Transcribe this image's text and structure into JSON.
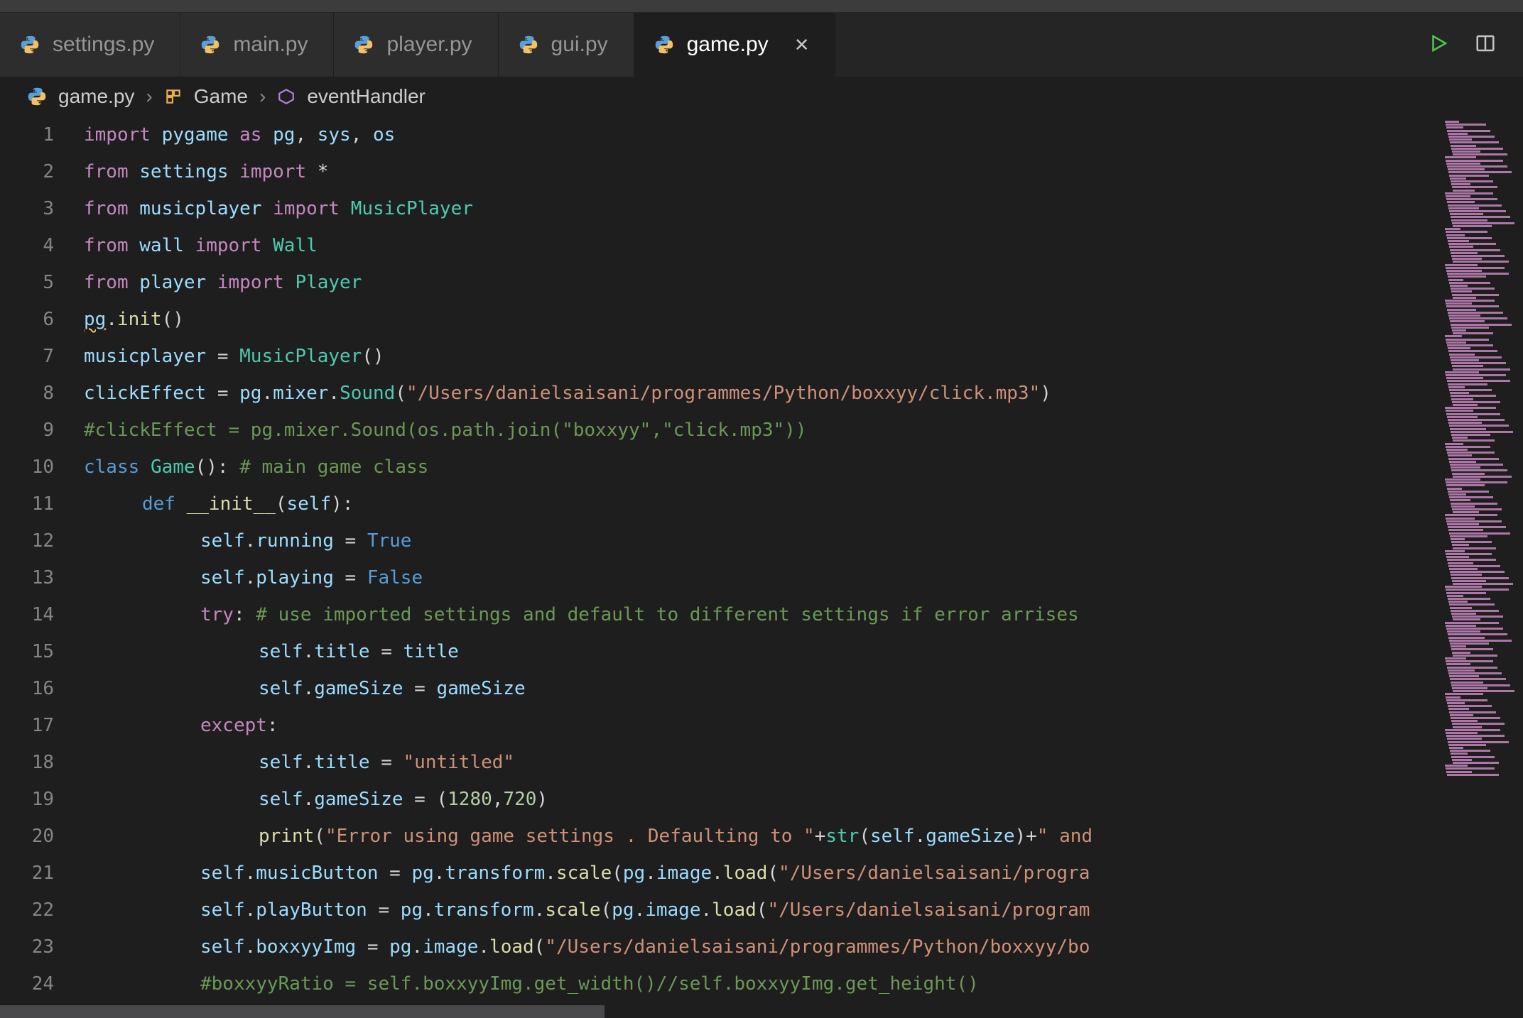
{
  "tabs": [
    {
      "label": "settings.py",
      "active": false
    },
    {
      "label": "main.py",
      "active": false
    },
    {
      "label": "player.py",
      "active": false
    },
    {
      "label": "gui.py",
      "active": false
    },
    {
      "label": "game.py",
      "active": true
    }
  ],
  "breadcrumb": {
    "file": "game.py",
    "class": "Game",
    "method": "eventHandler"
  },
  "icons": {
    "python": "python-icon",
    "close": "✕",
    "run": "▷",
    "chevron": "›",
    "class": "class-icon",
    "method": "method-icon",
    "split": "split-icon"
  },
  "code": [
    {
      "n": 1,
      "ind": 0,
      "spans": [
        [
          "kw",
          "import"
        ],
        [
          "op",
          " "
        ],
        [
          "var",
          "pygame"
        ],
        [
          "op",
          " "
        ],
        [
          "kw",
          "as"
        ],
        [
          "op",
          " "
        ],
        [
          "var",
          "pg"
        ],
        [
          "op",
          ", "
        ],
        [
          "var",
          "sys"
        ],
        [
          "op",
          ", "
        ],
        [
          "var",
          "os"
        ]
      ]
    },
    {
      "n": 2,
      "ind": 0,
      "spans": [
        [
          "kw",
          "from"
        ],
        [
          "op",
          " "
        ],
        [
          "var",
          "settings"
        ],
        [
          "op",
          " "
        ],
        [
          "kw",
          "import"
        ],
        [
          "op",
          " *"
        ]
      ]
    },
    {
      "n": 3,
      "ind": 0,
      "spans": [
        [
          "kw",
          "from"
        ],
        [
          "op",
          " "
        ],
        [
          "var",
          "musicplayer"
        ],
        [
          "op",
          " "
        ],
        [
          "kw",
          "import"
        ],
        [
          "op",
          " "
        ],
        [
          "cls",
          "MusicPlayer"
        ]
      ]
    },
    {
      "n": 4,
      "ind": 0,
      "spans": [
        [
          "kw",
          "from"
        ],
        [
          "op",
          " "
        ],
        [
          "var",
          "wall"
        ],
        [
          "op",
          " "
        ],
        [
          "kw",
          "import"
        ],
        [
          "op",
          " "
        ],
        [
          "cls",
          "Wall"
        ]
      ]
    },
    {
      "n": 5,
      "ind": 0,
      "spans": [
        [
          "kw",
          "from"
        ],
        [
          "op",
          " "
        ],
        [
          "var",
          "player"
        ],
        [
          "op",
          " "
        ],
        [
          "kw",
          "import"
        ],
        [
          "op",
          " "
        ],
        [
          "cls",
          "Player"
        ]
      ]
    },
    {
      "n": 6,
      "ind": 0,
      "spans": [
        [
          "var err",
          "pg"
        ],
        [
          "op",
          "."
        ],
        [
          "fn",
          "init"
        ],
        [
          "op",
          "()"
        ]
      ]
    },
    {
      "n": 7,
      "ind": 0,
      "spans": [
        [
          "var",
          "musicplayer"
        ],
        [
          "op",
          " = "
        ],
        [
          "cls",
          "MusicPlayer"
        ],
        [
          "op",
          "()"
        ]
      ]
    },
    {
      "n": 8,
      "ind": 0,
      "spans": [
        [
          "var",
          "clickEffect"
        ],
        [
          "op",
          " = "
        ],
        [
          "var",
          "pg"
        ],
        [
          "op",
          "."
        ],
        [
          "var",
          "mixer"
        ],
        [
          "op",
          "."
        ],
        [
          "cls",
          "Sound"
        ],
        [
          "op",
          "("
        ],
        [
          "str",
          "\"/Users/danielsaisani/programmes/Python/boxxyy/click.mp3\""
        ],
        [
          "op",
          ")"
        ]
      ]
    },
    {
      "n": 9,
      "ind": 0,
      "spans": [
        [
          "cmt",
          "#clickEffect = pg.mixer.Sound(os.path.join(\"boxxyy\",\"click.mp3\"))"
        ]
      ]
    },
    {
      "n": 10,
      "ind": 0,
      "spans": [
        [
          "kw2",
          "class"
        ],
        [
          "op",
          " "
        ],
        [
          "cls",
          "Game"
        ],
        [
          "op",
          "(): "
        ],
        [
          "cmt",
          "# main game class"
        ]
      ]
    },
    {
      "n": 11,
      "ind": 1,
      "spans": [
        [
          "kw2",
          "def"
        ],
        [
          "op",
          " "
        ],
        [
          "fn",
          "__init__"
        ],
        [
          "op",
          "("
        ],
        [
          "var",
          "self"
        ],
        [
          "op",
          ")"
        ],
        [
          "op",
          ":"
        ]
      ]
    },
    {
      "n": 12,
      "ind": 2,
      "spans": [
        [
          "var",
          "self"
        ],
        [
          "op",
          "."
        ],
        [
          "var",
          "running"
        ],
        [
          "op",
          " = "
        ],
        [
          "const",
          "True"
        ]
      ]
    },
    {
      "n": 13,
      "ind": 2,
      "spans": [
        [
          "var",
          "self"
        ],
        [
          "op",
          "."
        ],
        [
          "var",
          "playing"
        ],
        [
          "op",
          " = "
        ],
        [
          "const",
          "False"
        ]
      ]
    },
    {
      "n": 14,
      "ind": 2,
      "spans": [
        [
          "kw",
          "try"
        ],
        [
          "op",
          ": "
        ],
        [
          "cmt",
          "# use imported settings and default to different settings if error arrises"
        ]
      ]
    },
    {
      "n": 15,
      "ind": 3,
      "spans": [
        [
          "var",
          "self"
        ],
        [
          "op",
          "."
        ],
        [
          "var",
          "title"
        ],
        [
          "op",
          " = "
        ],
        [
          "var",
          "title"
        ]
      ]
    },
    {
      "n": 16,
      "ind": 3,
      "spans": [
        [
          "var",
          "self"
        ],
        [
          "op",
          "."
        ],
        [
          "var",
          "gameSize"
        ],
        [
          "op",
          " = "
        ],
        [
          "var",
          "gameSize"
        ]
      ]
    },
    {
      "n": 17,
      "ind": 2,
      "spans": [
        [
          "kw",
          "except"
        ],
        [
          "op",
          ":"
        ]
      ]
    },
    {
      "n": 18,
      "ind": 3,
      "spans": [
        [
          "var",
          "self"
        ],
        [
          "op",
          "."
        ],
        [
          "var",
          "title"
        ],
        [
          "op",
          " = "
        ],
        [
          "str",
          "\"untitled\""
        ]
      ]
    },
    {
      "n": 19,
      "ind": 3,
      "spans": [
        [
          "var",
          "self"
        ],
        [
          "op",
          "."
        ],
        [
          "var",
          "gameSize"
        ],
        [
          "op",
          " = ("
        ],
        [
          "num",
          "1280"
        ],
        [
          "op",
          ","
        ],
        [
          "num",
          "720"
        ],
        [
          "op",
          ")"
        ]
      ]
    },
    {
      "n": 20,
      "ind": 3,
      "spans": [
        [
          "fn",
          "print"
        ],
        [
          "op",
          "("
        ],
        [
          "str",
          "\"Error using game settings . Defaulting to \""
        ],
        [
          "op",
          "+"
        ],
        [
          "cls",
          "str"
        ],
        [
          "op",
          "("
        ],
        [
          "var",
          "self"
        ],
        [
          "op",
          "."
        ],
        [
          "var",
          "gameSize"
        ],
        [
          "op",
          ")+"
        ],
        [
          "str",
          "\" and "
        ]
      ]
    },
    {
      "n": 21,
      "ind": 2,
      "spans": [
        [
          "var",
          "self"
        ],
        [
          "op",
          "."
        ],
        [
          "var",
          "musicButton"
        ],
        [
          "op",
          " = "
        ],
        [
          "var",
          "pg"
        ],
        [
          "op",
          "."
        ],
        [
          "var",
          "transform"
        ],
        [
          "op",
          "."
        ],
        [
          "fn",
          "scale"
        ],
        [
          "op",
          "("
        ],
        [
          "var",
          "pg"
        ],
        [
          "op",
          "."
        ],
        [
          "var",
          "image"
        ],
        [
          "op",
          "."
        ],
        [
          "fn",
          "load"
        ],
        [
          "op",
          "("
        ],
        [
          "str",
          "\"/Users/danielsaisani/progra"
        ]
      ]
    },
    {
      "n": 22,
      "ind": 2,
      "spans": [
        [
          "var",
          "self"
        ],
        [
          "op",
          "."
        ],
        [
          "var",
          "playButton"
        ],
        [
          "op",
          " = "
        ],
        [
          "var",
          "pg"
        ],
        [
          "op",
          "."
        ],
        [
          "var",
          "transform"
        ],
        [
          "op",
          "."
        ],
        [
          "fn",
          "scale"
        ],
        [
          "op",
          "("
        ],
        [
          "var",
          "pg"
        ],
        [
          "op",
          "."
        ],
        [
          "var",
          "image"
        ],
        [
          "op",
          "."
        ],
        [
          "fn",
          "load"
        ],
        [
          "op",
          "("
        ],
        [
          "str",
          "\"/Users/danielsaisani/program"
        ]
      ]
    },
    {
      "n": 23,
      "ind": 2,
      "spans": [
        [
          "var",
          "self"
        ],
        [
          "op",
          "."
        ],
        [
          "var",
          "boxxyyImg"
        ],
        [
          "op",
          " = "
        ],
        [
          "var",
          "pg"
        ],
        [
          "op",
          "."
        ],
        [
          "var",
          "image"
        ],
        [
          "op",
          "."
        ],
        [
          "fn",
          "load"
        ],
        [
          "op",
          "("
        ],
        [
          "str",
          "\"/Users/danielsaisani/programmes/Python/boxxyy/bo"
        ]
      ]
    },
    {
      "n": 24,
      "ind": 2,
      "spans": [
        [
          "cmt",
          "#boxxyyRatio = self.boxxyyImg.get_width()//self.boxxyyImg.get_height()"
        ]
      ]
    }
  ]
}
